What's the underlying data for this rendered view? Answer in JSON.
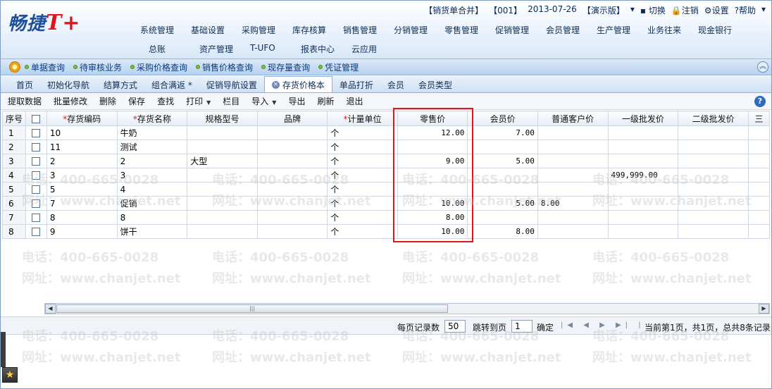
{
  "topbar": {
    "mode": "【销货单合并】",
    "account": "【001】",
    "date": "2013-07-26",
    "edition": "【演示版】",
    "switch": "切换",
    "logout": "注销",
    "settings": "设置",
    "help": "帮助"
  },
  "logo": {
    "text": "畅捷",
    "suffix": "T+"
  },
  "menu_row1": [
    "系统管理",
    "基础设置",
    "采购管理",
    "库存核算",
    "销售管理",
    "分销管理",
    "零售管理",
    "促销管理",
    "会员管理",
    "生产管理",
    "业务往来",
    "现金银行"
  ],
  "menu_row2": [
    "总账",
    "资产管理",
    "T-UFO",
    "报表中心",
    "云应用"
  ],
  "quickbar": [
    "单据查询",
    "待审核业务",
    "采购价格查询",
    "销售价格查询",
    "现存量查询",
    "凭证管理"
  ],
  "tabs": [
    "首页",
    "初始化导航",
    "结算方式",
    "组合满返 *",
    "促销导航设置",
    "存货价格本",
    "单品打折",
    "会员",
    "会员类型"
  ],
  "active_tab": "存货价格本",
  "toolbar": [
    "提取数据",
    "批量修改",
    "删除",
    "保存",
    "查找",
    "打印",
    "栏目",
    "导入",
    "导出",
    "刷新",
    "退出"
  ],
  "columns": [
    "序号",
    "",
    "存货编码",
    "存货名称",
    "规格型号",
    "品牌",
    "计量单位",
    "零售价",
    "会员价",
    "普通客户价",
    "一级批发价",
    "二级批发价",
    "三"
  ],
  "rows": [
    [
      "1",
      "10",
      "牛奶",
      "",
      "",
      "个",
      "12.00",
      "7.00",
      "",
      "",
      ""
    ],
    [
      "2",
      "11",
      "测试",
      "",
      "",
      "个",
      "",
      "",
      "",
      "",
      ""
    ],
    [
      "3",
      "2",
      "2",
      "大型",
      "",
      "个",
      "9.00",
      "5.00",
      "",
      "",
      ""
    ],
    [
      "4",
      "3",
      "3",
      "",
      "",
      "个",
      "",
      "",
      "",
      "499,999.00",
      ""
    ],
    [
      "5",
      "5",
      "4",
      "",
      "",
      "个",
      "",
      "",
      "",
      "",
      ""
    ],
    [
      "6",
      "7",
      "促销",
      "",
      "",
      "个",
      "10.00",
      "5.00",
      "8.00",
      "",
      ""
    ],
    [
      "7",
      "8",
      "8",
      "",
      "",
      "个",
      "8.00",
      "",
      "",
      "",
      ""
    ],
    [
      "8",
      "9",
      "饼干",
      "",
      "",
      "个",
      "10.00",
      "8.00",
      "",
      "",
      ""
    ]
  ],
  "pager": {
    "per_page_label": "每页记录数",
    "per_page": "50",
    "jump_label": "跳转到页",
    "page": "1",
    "confirm": "确定",
    "summary": "当前第1页，共1页，总共8条记录"
  },
  "watermark": {
    "phone": "电话：400-665-0028",
    "site": "网址：www.chanjet.net"
  },
  "colors": {
    "highlight": "#e2141c",
    "required": "#e01b1b",
    "accent": "#2e6cc0"
  }
}
